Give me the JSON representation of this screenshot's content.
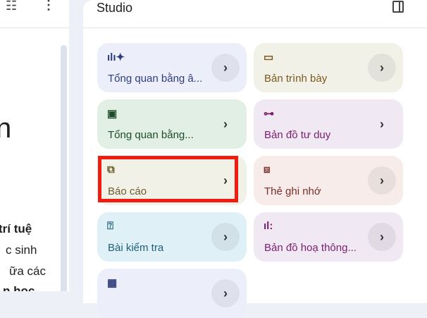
{
  "left_panel": {
    "heading_fragment": "n",
    "text_lines": [
      "trí tuệ",
      "c sinh",
      "ữa các",
      "n học"
    ]
  },
  "studio": {
    "title": "Studio",
    "cards": [
      {
        "label": "Tổng quan bằng â...",
        "icon": "audio-overview-icon",
        "color": "#eceefa",
        "text": "#2f3e7a"
      },
      {
        "label": "Bản trình bày",
        "icon": "slides-icon",
        "color": "#f2f1e8",
        "text": "#7a5a1e"
      },
      {
        "label": "Tổng quan bằng...",
        "icon": "video-overview-icon",
        "color": "#e1efe4",
        "text": "#1f4d2a"
      },
      {
        "label": "Bản đồ tư duy",
        "icon": "mind-map-icon",
        "color": "#f0e8f2",
        "text": "#7a1f6e"
      },
      {
        "label": "Báo cáo",
        "icon": "report-icon",
        "color": "#f2f1e8",
        "text": "#6b5a2e"
      },
      {
        "label": "Thẻ ghi nhớ",
        "icon": "flashcards-icon",
        "color": "#f7ecea",
        "text": "#7a2e2a"
      },
      {
        "label": "Bài kiểm tra",
        "icon": "quiz-icon",
        "color": "#dff0f6",
        "text": "#1e5f7a"
      },
      {
        "label": "Bản đồ hoạ thông...",
        "icon": "infographic-icon",
        "color": "#f0e8f2",
        "text": "#7a1f6e"
      },
      {
        "label": "",
        "icon": "data-table-icon",
        "color": "#eceefa",
        "text": "#2f3e7a"
      }
    ]
  }
}
